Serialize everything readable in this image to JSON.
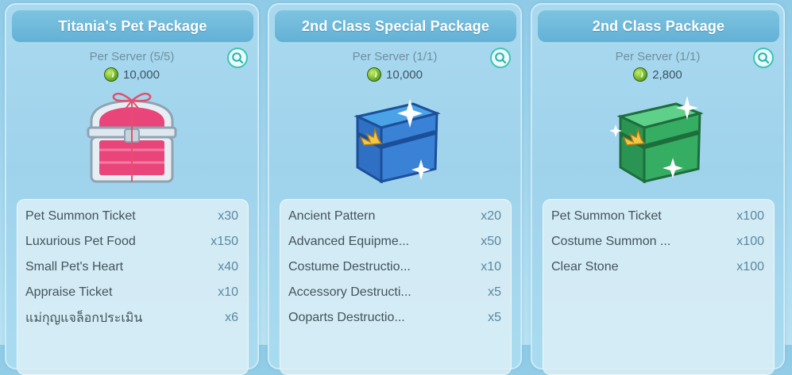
{
  "cards": [
    {
      "title": "Titania's Pet Package",
      "limit": "Per Server (5/5)",
      "price": "10,000",
      "icon": "pink-gift-chest-icon",
      "items": [
        {
          "name": "Pet Summon Ticket",
          "qty": "x30"
        },
        {
          "name": "Luxurious Pet Food",
          "qty": "x150"
        },
        {
          "name": "Small Pet's Heart",
          "qty": "x40"
        },
        {
          "name": "Appraise Ticket",
          "qty": "x10"
        },
        {
          "name": "แม่กุญแจล็อกประเมิน",
          "qty": "x6"
        }
      ]
    },
    {
      "title": "2nd Class Special Package",
      "limit": "Per Server (1/1)",
      "price": "10,000",
      "icon": "blue-crown-box-icon",
      "items": [
        {
          "name": "Ancient Pattern",
          "qty": "x20"
        },
        {
          "name": "Advanced Equipme...",
          "qty": "x50"
        },
        {
          "name": "Costume Destructio...",
          "qty": "x10"
        },
        {
          "name": "Accessory Destructi...",
          "qty": "x5"
        },
        {
          "name": "Ooparts Destructio...",
          "qty": "x5"
        }
      ]
    },
    {
      "title": "2nd Class Package",
      "limit": "Per Server (1/1)",
      "price": "2,800",
      "icon": "green-crown-box-icon",
      "items": [
        {
          "name": "Pet Summon Ticket",
          "qty": "x100"
        },
        {
          "name": "Costume Summon ...",
          "qty": "x100"
        },
        {
          "name": "Clear Stone",
          "qty": "x100"
        }
      ]
    }
  ],
  "currency_icon": "green-leaf-coin-icon",
  "colors": {
    "header": "#62b1d6",
    "zoom_ring": "#3fc3b6",
    "pink_chest": "#e8457a",
    "blue_box": "#2f6fc4",
    "green_box": "#2fa45c"
  }
}
